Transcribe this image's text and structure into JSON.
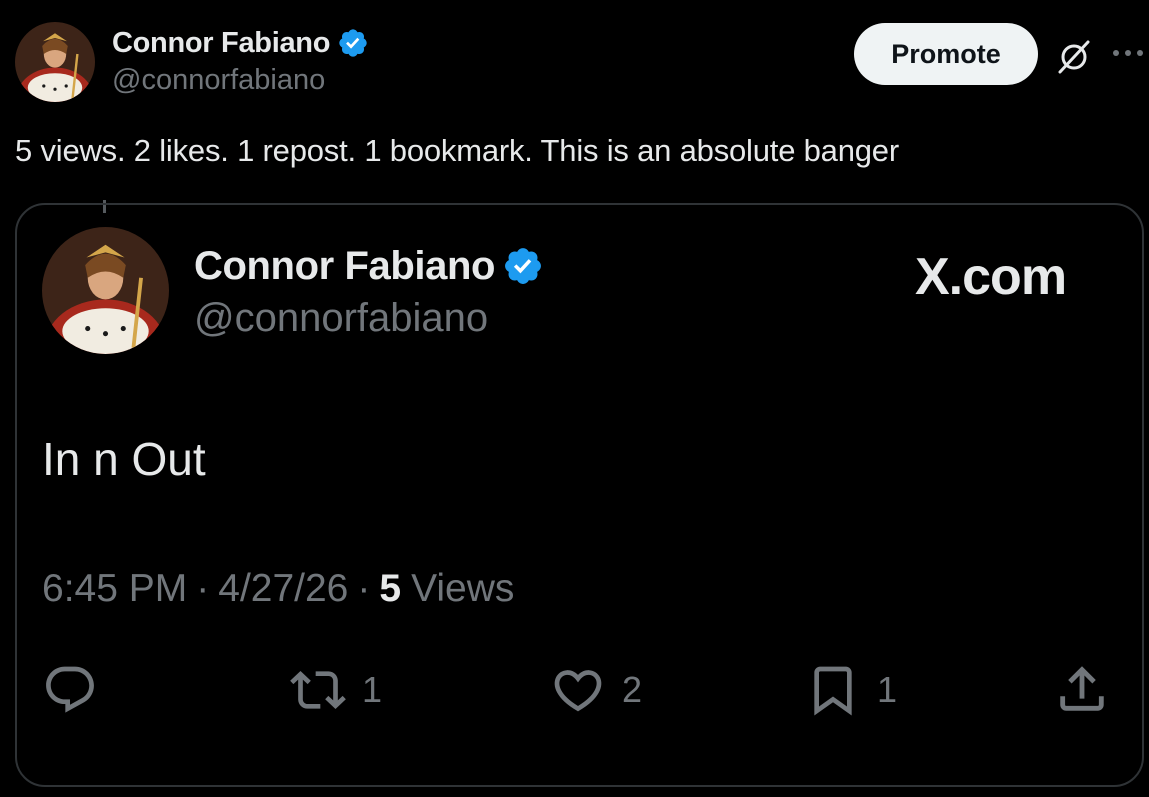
{
  "author": {
    "name": "Connor Fabiano",
    "handle": "@connorfabiano",
    "verified": true
  },
  "header": {
    "promote_label": "Promote",
    "grok_icon": "grok-slash-circle-icon",
    "more_icon": "more-horizontal-icon"
  },
  "post": {
    "text": "5 views. 2 likes. 1 repost. 1 bookmark. This is an absolute banger"
  },
  "embedded": {
    "author_name": "Connor Fabiano",
    "author_handle": "@connorfabiano",
    "brand_label": "X.com",
    "text": "In n Out",
    "time": "6:45 PM",
    "separator": "·",
    "date": "4/27/26",
    "views_count": "5",
    "views_label": "Views",
    "actions": {
      "reply_count": "",
      "repost_count": "1",
      "like_count": "2",
      "bookmark_count": "1"
    }
  },
  "colors": {
    "background": "#000000",
    "primary_text": "#e7e9ea",
    "secondary_text": "#71767b",
    "verified_badge": "#1d9bf0",
    "card_border": "#2f3336",
    "promote_bg": "#eff3f4"
  }
}
